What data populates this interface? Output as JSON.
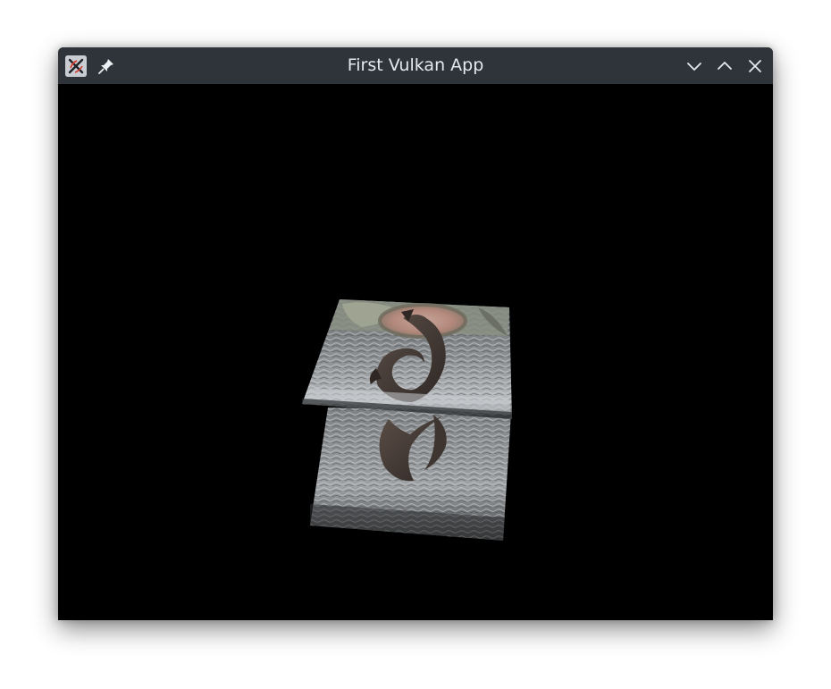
{
  "window": {
    "title": "First Vulkan App"
  },
  "titlebar": {
    "app_icon": "x11-app-icon",
    "pin_icon": "pin-icon",
    "controls": [
      {
        "name": "minimize-button",
        "icon": "chevron-down-icon"
      },
      {
        "name": "maximize-button",
        "icon": "chevron-up-icon"
      },
      {
        "name": "close-button",
        "icon": "close-icon"
      }
    ]
  },
  "viewport": {
    "background": "#000000",
    "content": "two textured quads with water and dolphin texture"
  },
  "colors": {
    "titlebar_bg": "#2f343a",
    "title_text": "#e6e9ec"
  }
}
